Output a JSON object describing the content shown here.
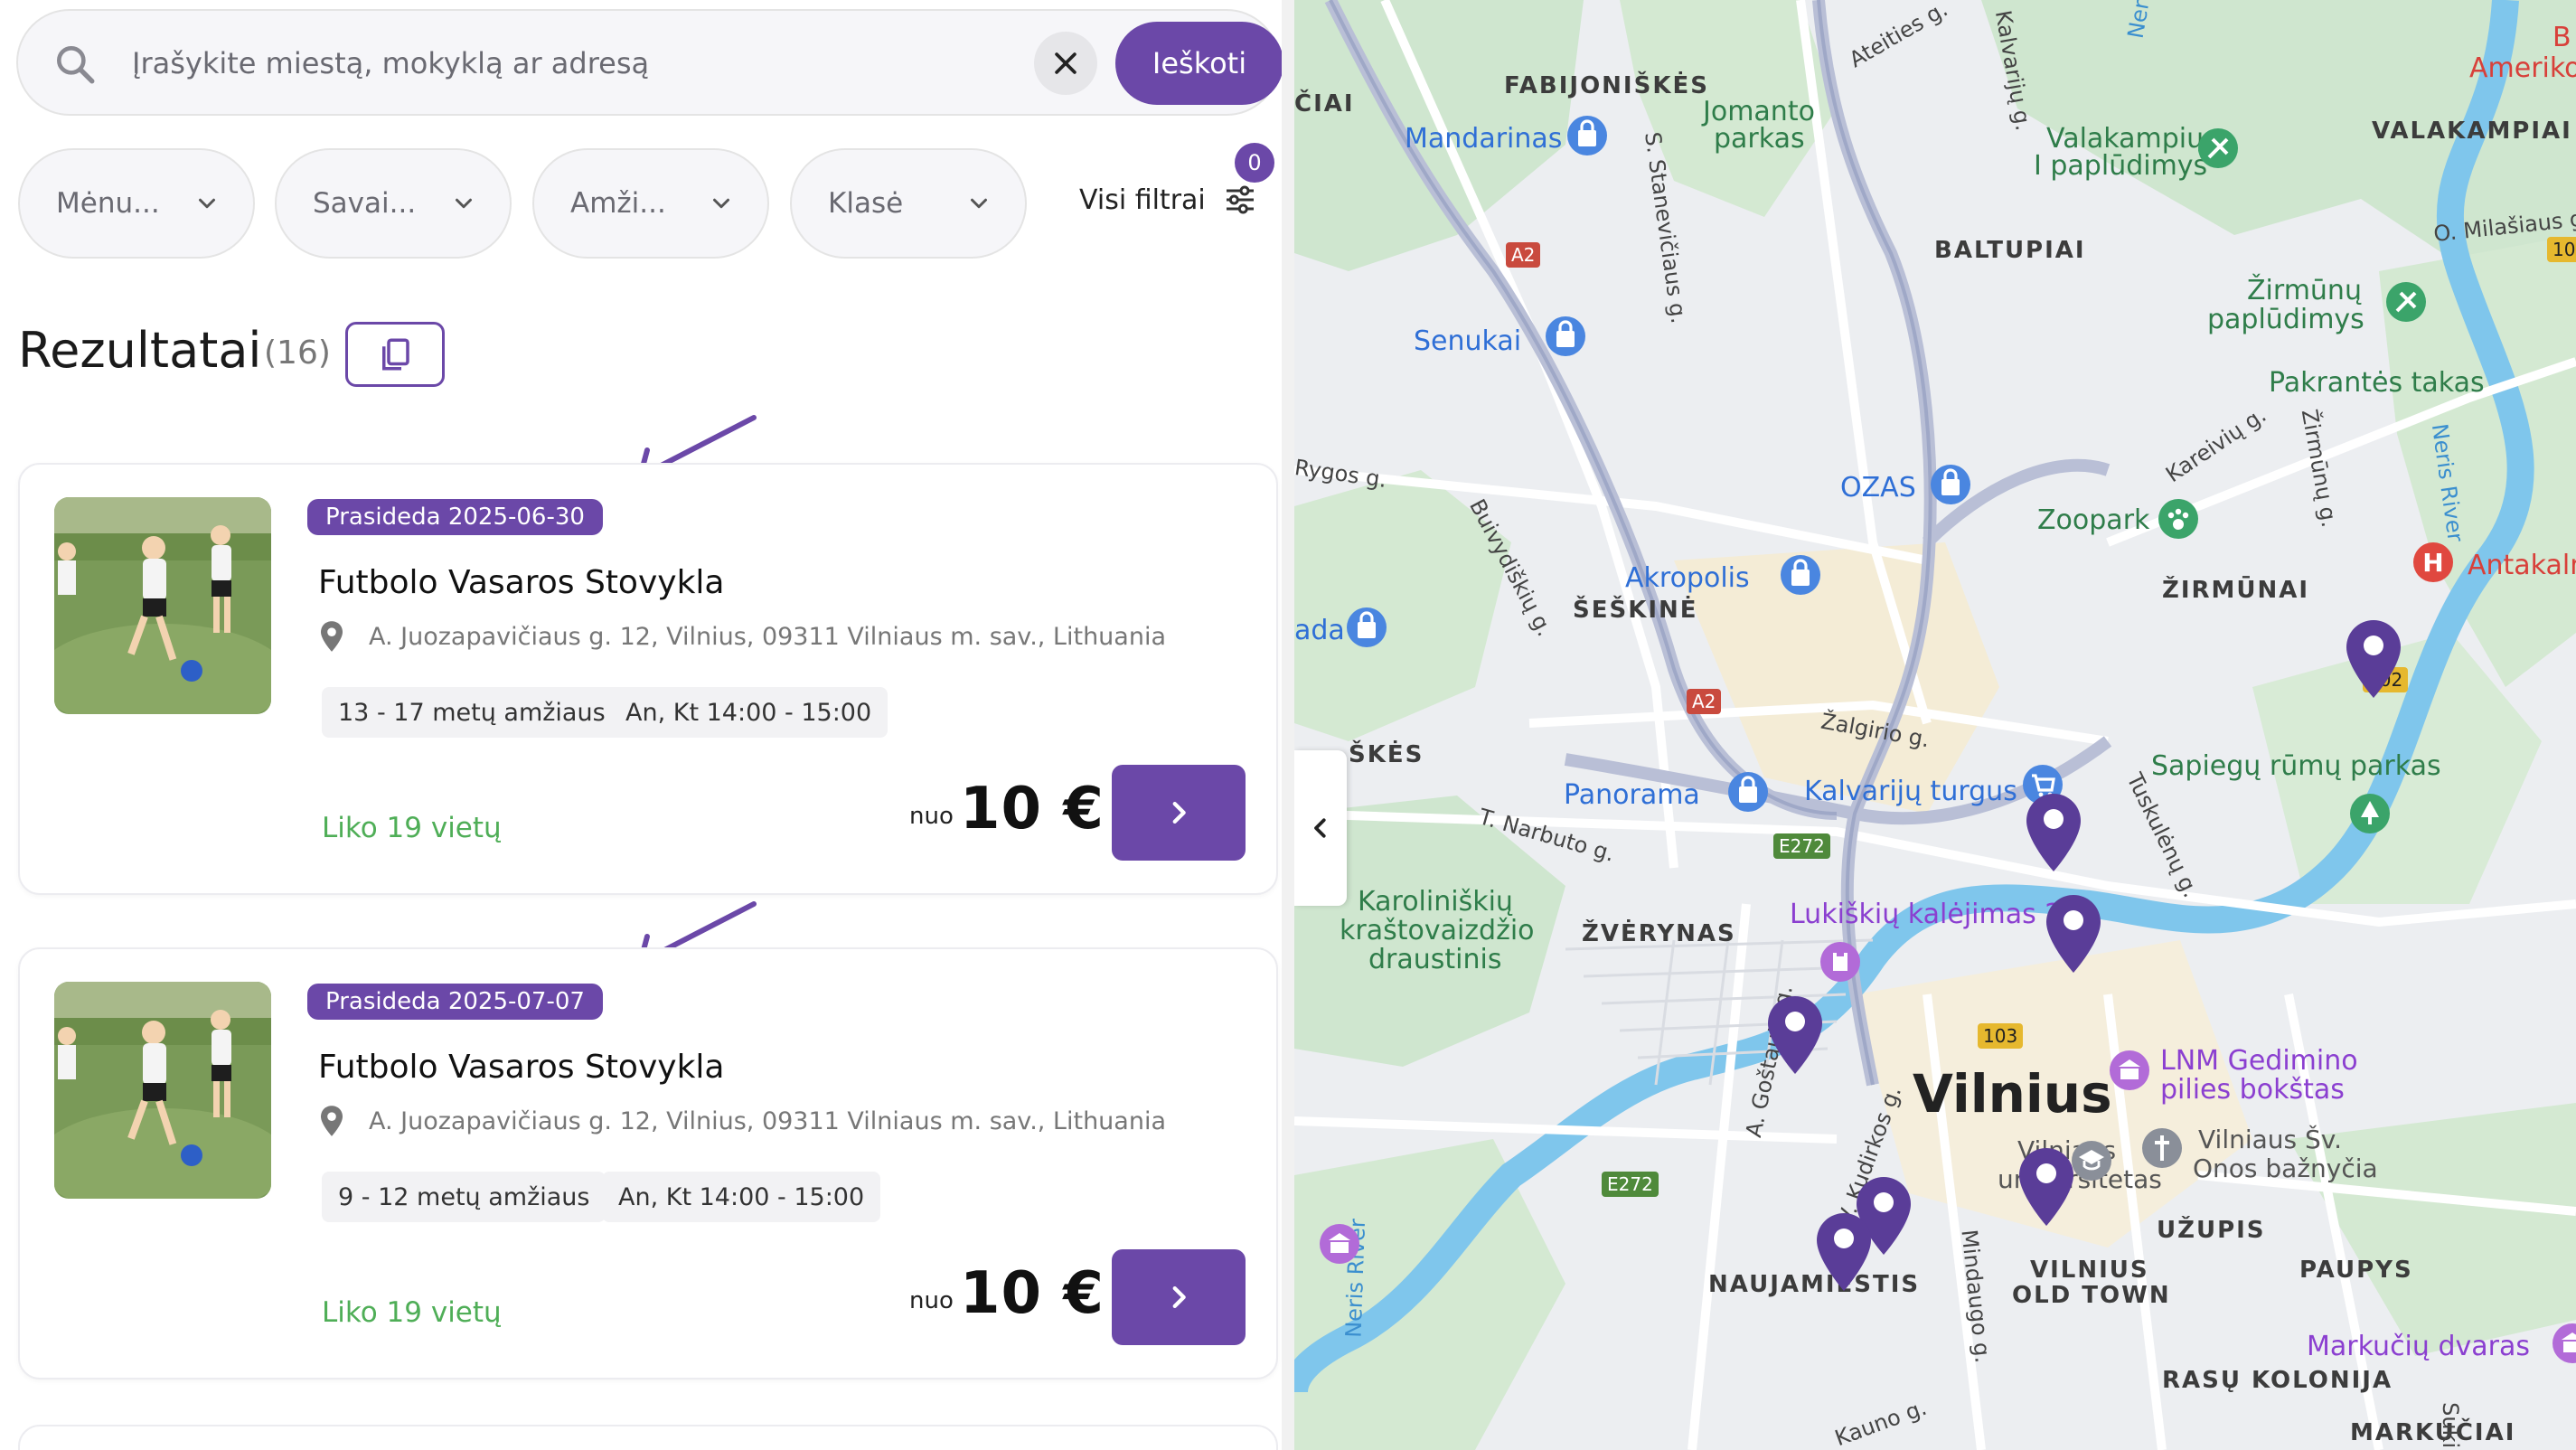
{
  "search": {
    "placeholder": "Įrašykite miestą, mokyklą ar adresą",
    "button_label": "Ieškoti"
  },
  "filters": {
    "items": [
      {
        "label": "Mėnu..."
      },
      {
        "label": "Savai..."
      },
      {
        "label": "Amži..."
      },
      {
        "label": "Klasė"
      }
    ],
    "all_filters_label": "Visi filtrai",
    "active_count": "0"
  },
  "results": {
    "title": "Rezultatai",
    "count": "(16)"
  },
  "cards": [
    {
      "badge": "Prasideda 2025-06-30",
      "title": "Futbolo Vasaros Stovykla",
      "address": "A. Juozapavičiaus g. 12, Vilnius, 09311 Vilniaus m. sav., Lithuania",
      "age": "13 - 17 metų amžiaus",
      "schedule": "An, Kt 14:00 - 15:00",
      "spots": "Liko 19 vietų",
      "price_prefix": "nuo",
      "price": "10 €"
    },
    {
      "badge": "Prasideda 2025-07-07",
      "title": "Futbolo Vasaros Stovykla",
      "address": "A. Juozapavičiaus g. 12, Vilnius, 09311 Vilniaus m. sav., Lithuania",
      "age": "9 - 12 metų amžiaus",
      "schedule": "An, Kt 14:00 - 15:00",
      "spots": "Liko 19 vietų",
      "price_prefix": "nuo",
      "price": "10 €"
    }
  ],
  "map": {
    "city": "Vilnius",
    "districts": [
      "FABIJONIŠKĖS",
      "VALAKAMPIAI",
      "BALTUPIAI",
      "ŠEŠKINĖ",
      "ŽIRMŪNAI",
      "ŽVĖRYNAS",
      "UŽUPIS",
      "PAUPYS",
      "NAUJAMIESTIS",
      "VILNIUS",
      "OLD TOWN",
      "RASŲ KOLONIJA",
      "MARKUČIAI",
      "ČIAI",
      "ŠKĖS"
    ],
    "parks": [
      "Jomanto",
      "parkas",
      "Valakampių",
      "I paplūdimys",
      "Žirmūnų",
      "paplūdimys",
      "Pakrantės takas",
      "Zoopark",
      "Sapiegų rūmų parkas",
      "Karoliniškių",
      "kraštovaizdžio",
      "draustinis"
    ],
    "pois": [
      "Mandarinas",
      "Senukai",
      "OZAS",
      "Akropolis",
      "Panorama",
      "Kalvarijų turgus",
      "ada"
    ],
    "purple_pois": [
      "Lukiškių kalėjimas 2",
      "LNM Gedimino",
      "pilies bokštas",
      "Markučių dvaras"
    ],
    "other_labels": [
      "Vilniaus",
      "universitetas",
      "Vilniaus Šv.",
      "Onos bažnyčia"
    ],
    "red_labels": [
      "Antakaln",
      "B",
      "Ameriko"
    ],
    "streets": [
      "Ateities g.",
      "Kalvarijų g.",
      "S. Stanevičiaus g.",
      "Rygos g.",
      "Buivydiškių g.",
      "Kareivių g.",
      "Žirmūnų g.",
      "O. Milašiaus g.",
      "Žalgirio g.",
      "T. Narbuto g.",
      "Tuskulėnų g.",
      "A. Goštauto g.",
      "V. Kudirkos g.",
      "Mindaugo g.",
      "Kauno g.",
      "Neris River",
      "Sukil",
      "Neri"
    ],
    "road_shields": [
      "A2",
      "A2",
      "E272",
      "E272",
      "103",
      "10",
      "102"
    ]
  },
  "colors": {
    "accent": "#6b48a8",
    "spots": "#4fae57",
    "pin": "#5a3d98"
  }
}
